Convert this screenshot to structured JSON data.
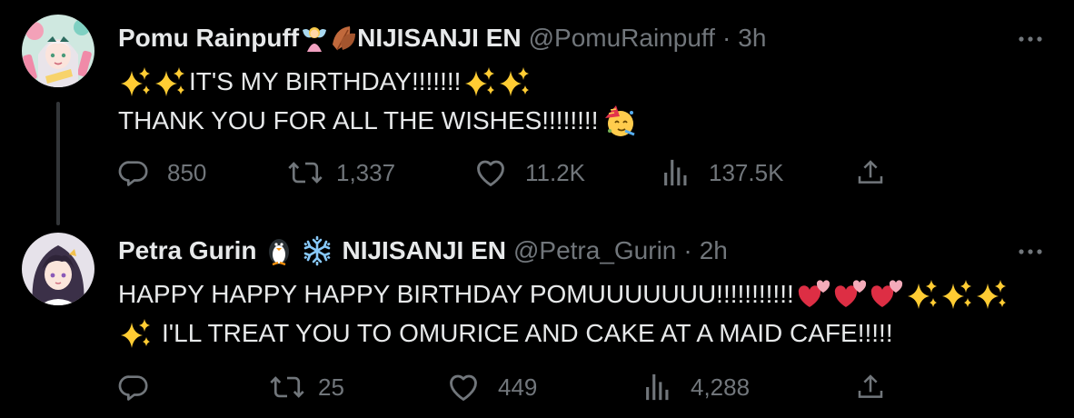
{
  "colors": {
    "background": "#000000",
    "text": "#e7e9ea",
    "muted": "#71767b",
    "thread_line": "#333639"
  },
  "tweets": [
    {
      "display_name": "Pomu Rainpuff",
      "org": "NIJISANJI EN",
      "handle": "@PomuRainpuff",
      "separator": "·",
      "time": "3h",
      "lines": [
        "IT'S MY BIRTHDAY!!!!!!!",
        "THANK YOU FOR ALL THE WISHES!!!!!!!!"
      ],
      "icons": [
        "fairy-emoji",
        "leaf-emoji",
        "sparkles-emoji",
        "partying-face-emoji"
      ],
      "stats": {
        "replies": "850",
        "retweets": "1,337",
        "likes": "11.2K",
        "views": "137.5K"
      }
    },
    {
      "display_name": "Petra Gurin",
      "org": "NIJISANJI EN",
      "handle": "@Petra_Gurin",
      "separator": "·",
      "time": "2h",
      "lines": [
        "HAPPY HAPPY HAPPY BIRTHDAY POMUUUUUUU!!!!!!!!!!!",
        "I'LL TREAT YOU TO OMURICE AND CAKE AT A MAID CAFE!!!!!"
      ],
      "icons": [
        "penguin-emoji",
        "snowflake-emoji",
        "two-hearts-emoji",
        "sparkles-emoji"
      ],
      "stats": {
        "replies": "",
        "retweets": "25",
        "likes": "449",
        "views": "4,288"
      }
    }
  ]
}
